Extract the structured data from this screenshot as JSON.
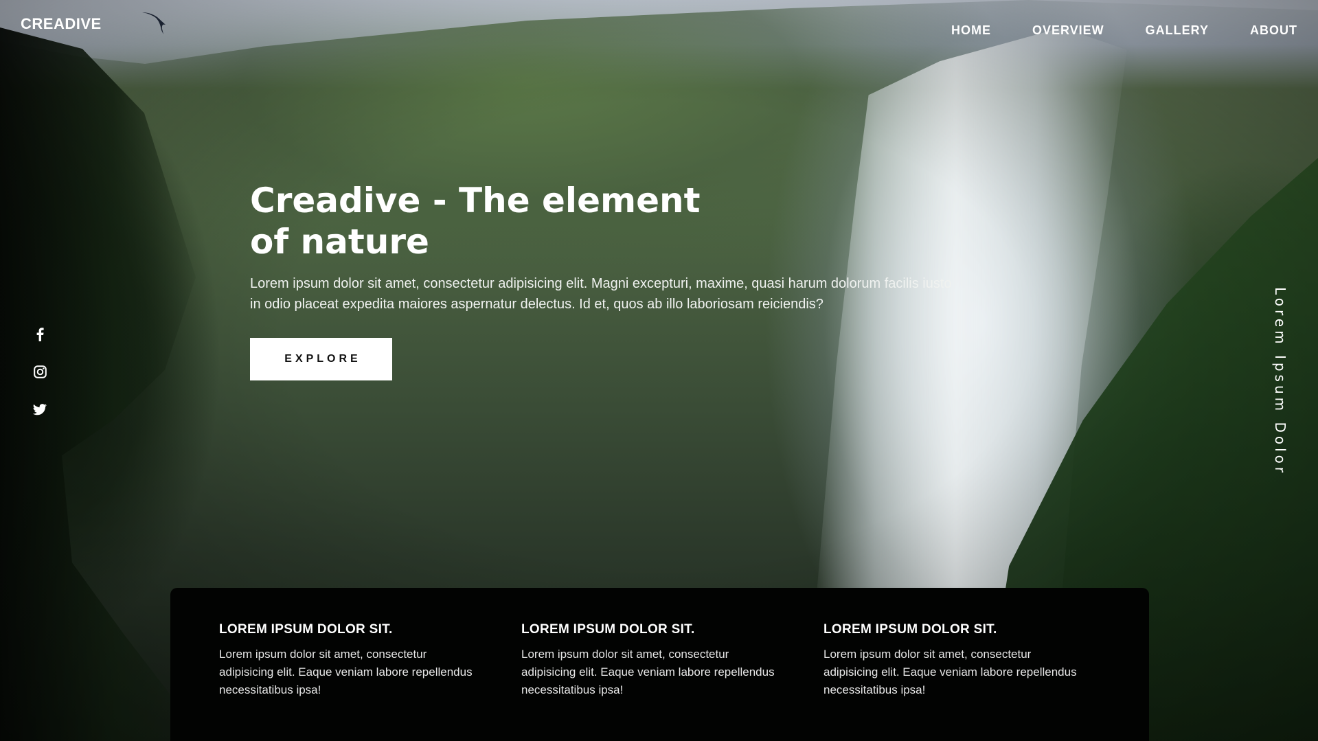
{
  "header": {
    "logo": "CREADIVE",
    "nav": [
      {
        "label": "HOME"
      },
      {
        "label": "OVERVIEW"
      },
      {
        "label": "GALLERY"
      },
      {
        "label": "ABOUT"
      }
    ]
  },
  "hero": {
    "title_line1": "Creadive - The element",
    "title_line2": "of nature",
    "text": "Lorem ipsum dolor sit amet, consectetur adipisicing elit. Magni excepturi, maxime, quasi harum dolorum facilis iusto in odio placeat expedita maiores aspernatur delectus. Id et, quos ab illo laboriosam reiciendis?",
    "button_label": "EXPLORE"
  },
  "social": [
    {
      "icon": "facebook-icon"
    },
    {
      "icon": "instagram-icon"
    },
    {
      "icon": "twitter-icon"
    }
  ],
  "side_text": "Lorem Ipsum Dolor",
  "features": [
    {
      "title": "LOREM IPSUM DOLOR SIT.",
      "text": "Lorem ipsum dolor sit amet, consectetur adipisicing elit. Eaque veniam labore repellendus necessitatibus ipsa!"
    },
    {
      "title": "LOREM IPSUM DOLOR SIT.",
      "text": "Lorem ipsum dolor sit amet, consectetur adipisicing elit. Eaque veniam labore repellendus necessitatibus ipsa!"
    },
    {
      "title": "LOREM IPSUM DOLOR SIT.",
      "text": "Lorem ipsum dolor sit amet, consectetur adipisicing elit. Eaque veniam labore repellendus necessitatibus ipsa!"
    }
  ],
  "colors": {
    "button_bg": "#ffffff",
    "panel_bg": "#020302",
    "text": "#ffffff"
  }
}
